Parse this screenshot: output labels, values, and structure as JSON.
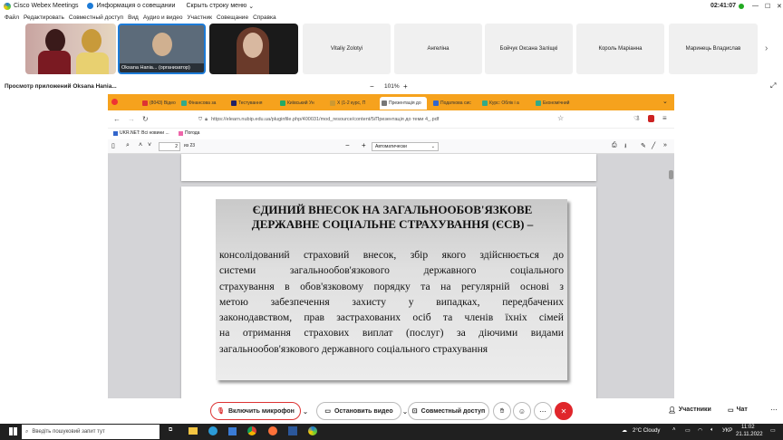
{
  "titlebar": {
    "app": "Cisco Webex Meetings",
    "info": "Информация о совещании",
    "hide": "Скрыть строку меню",
    "time": "02:41:07"
  },
  "menubar": [
    "Файл",
    "Редактировать",
    "Совместный доступ",
    "Вид",
    "Аудио и видео",
    "Участник",
    "Совещание",
    "Справка"
  ],
  "participants": {
    "host_label": "Oksana Hania... (организатор)",
    "names": [
      "Vitaliy Zolotyi",
      "Ангеліна",
      "Бойчук Оксана Заліщкі",
      "Король Марiанна",
      "Маринець Владислав"
    ]
  },
  "share": {
    "title": "Просмотр приложений Oksana Hania...",
    "zoom": "101%",
    "minus": "−",
    "plus": "+"
  },
  "browser": {
    "tabs": [
      {
        "label": "(8043) Відео",
        "color": "#d33"
      },
      {
        "label": "Фінансова за",
        "color": "#3a8"
      },
      {
        "label": "Тестування",
        "color": "#226"
      },
      {
        "label": "Київський Ун",
        "color": "#2a6"
      },
      {
        "label": "Х (1-2 курс, П",
        "color": "#c93"
      },
      {
        "label": "Презентація до",
        "color": "#777"
      },
      {
        "label": "Податкова сис",
        "color": "#36c"
      },
      {
        "label": "Курс: Облік і а",
        "color": "#3a8"
      },
      {
        "label": "Економічний",
        "color": "#3a8"
      }
    ],
    "url": "https://elearn.nubip.edu.ua/pluginfile.php/400031/mod_resource/content/5/Презентація до теми 4_.pdf",
    "bookmarks": [
      "UKR.NET: Всі новини ...",
      "Погода"
    ],
    "pdf": {
      "page": "2",
      "of": "из 23",
      "zoom": "Автоматически"
    }
  },
  "slide": {
    "heading": "ЄДИНИЙ ВНЕСОК НА ЗАГАЛЬНООБОВ'ЯЗКОВЕ ДЕРЖАВНЕ СОЦІАЛЬНЕ СТРАХУВАННЯ (ЄСВ) –",
    "lines": [
      "консолідований страховий внесок, збір якого здійснюється до",
      "системи загальнообов'язкового державного соціального",
      "страхування в обов'язковому порядку та на регулярній основі з",
      "метою забезпечення захисту у випадках, передбачених",
      "законодавством, прав застрахованих осіб та членів їхніх сімей",
      "на отримання страхових виплат (послуг) за діючими видами",
      "загальнообов'язкового державного соціального страхування"
    ]
  },
  "controls": {
    "mic": "Включить микрофон",
    "video": "Остановить видео",
    "share": "Совместный доступ",
    "participants": "Участники",
    "chat": "Чат"
  },
  "taskbar": {
    "search": "Введіть пошуковий запит тут",
    "weather": "2°C Cloudy",
    "lang": "УКР",
    "time": "11:02",
    "date": "21.11.2022"
  },
  "colors": {
    "end_call": "#e0262b",
    "tab_strip": "#f6a21d",
    "webex_blue": "#1d7bd7"
  }
}
